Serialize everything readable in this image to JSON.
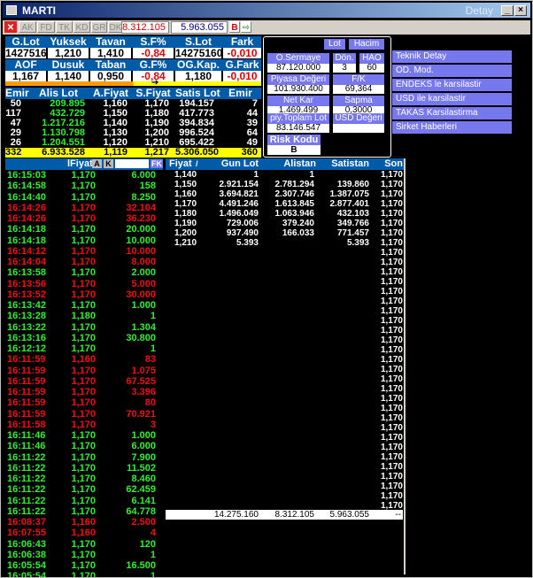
{
  "window": {
    "title": "MARTI",
    "detay_label": "Detay"
  },
  "toolbar": {
    "tabs": [
      "AK",
      "FD",
      "TK",
      "KD",
      "GR",
      "DK"
    ],
    "price": "8.312.105",
    "volume": "5.963.055",
    "b_label": "B"
  },
  "summary": {
    "row1_headers": [
      "G.Lot",
      "Yuksek",
      "Tavan",
      "S.F%",
      "S.Lot",
      "Fark"
    ],
    "row1_values": [
      "14275160",
      "1,210",
      "1,410",
      "-0,84",
      "14275160",
      "-0,010"
    ],
    "row2_headers": [
      "AOF",
      "Dusuk",
      "Taban",
      "G.F%",
      "OG.Kap.",
      "G.Fark"
    ],
    "row2_values": [
      "1,167",
      "1,140",
      "0,950",
      "-0,84",
      "1,180",
      "-0,010"
    ]
  },
  "depth": {
    "headers": [
      "Emir",
      "Alis Lot",
      "A.Fiyat",
      "S.Fiyat",
      "Satis Lot",
      "Emir"
    ],
    "rows": [
      [
        "50",
        "209.895",
        "1,160",
        "1,170",
        "194.157",
        "7"
      ],
      [
        "117",
        "432.729",
        "1,150",
        "1,180",
        "417.773",
        "44"
      ],
      [
        "47",
        "1.217.216",
        "1,140",
        "1,190",
        "394.834",
        "39"
      ],
      [
        "29",
        "1.130.798",
        "1,130",
        "1,200",
        "996.524",
        "64"
      ],
      [
        "26",
        "1.204.551",
        "1,120",
        "1,210",
        "695.422",
        "49"
      ]
    ],
    "total": [
      "332",
      "6.933.528",
      "1,119",
      "1,217",
      "5.306.050",
      "360"
    ]
  },
  "panel": {
    "lot_label": "Lot",
    "hacim_label": "Hacim",
    "osermaye_label": "O.Sermaye",
    "osermaye_value": "87.120.000",
    "don_label": "Dön.",
    "don_value": "3",
    "hao_label": "HAO",
    "hao_value": "60",
    "piyasa_label": "Piyasa Değeri",
    "piyasa_value": "101.930.400",
    "fk_label": "F/K",
    "fk_value": "69,364",
    "netkar_label": "Net Kar",
    "netkar_value": "1.469.499",
    "sapma_label": "Sapma",
    "sapma_value": "0,3000",
    "piytop_label": "piy.Toplam Lot",
    "piytop_value": "83.146.547",
    "usd_label": "USD Değeri",
    "risk_label": "Risk Kodu",
    "risk_value": "B"
  },
  "menu": [
    "Teknik Detay",
    "OD. Mod.",
    "ENDEKS le karsilastir",
    "USD ile karsilastir",
    "TAKAS Karsilastirma",
    "Sirket Haberleri"
  ],
  "trades_header": {
    "fiyat": "lFiyat",
    "a": "A",
    "k": "K",
    "fk": "FK"
  },
  "trades": [
    [
      "16:15:03",
      "1,170",
      "6.000",
      "g"
    ],
    [
      "16:14:58",
      "1,170",
      "158",
      "g"
    ],
    [
      "16:14:40",
      "1,170",
      "8.250",
      "g"
    ],
    [
      "16:14:26",
      "1,170",
      "32.104",
      "r"
    ],
    [
      "16:14:26",
      "1,170",
      "36.230",
      "r"
    ],
    [
      "16:14:18",
      "1,170",
      "20.000",
      "g"
    ],
    [
      "16:14:18",
      "1,170",
      "10.000",
      "g"
    ],
    [
      "16:14:12",
      "1,170",
      "10.000",
      "r"
    ],
    [
      "16:14:04",
      "1,170",
      "8.000",
      "r"
    ],
    [
      "16:13:58",
      "1,170",
      "2.000",
      "g"
    ],
    [
      "16:13:56",
      "1,170",
      "5.000",
      "r"
    ],
    [
      "16:13:52",
      "1,170",
      "30.000",
      "r"
    ],
    [
      "16:13:42",
      "1,170",
      "1.000",
      "g"
    ],
    [
      "16:13:28",
      "1,180",
      "1",
      "g"
    ],
    [
      "16:13:22",
      "1,170",
      "1.304",
      "g"
    ],
    [
      "16:13:16",
      "1,170",
      "30.800",
      "g"
    ],
    [
      "16:12:12",
      "1,170",
      "1",
      "g"
    ],
    [
      "16:11:59",
      "1,160",
      "83",
      "r"
    ],
    [
      "16:11:59",
      "1,170",
      "1.075",
      "r"
    ],
    [
      "16:11:59",
      "1,170",
      "67.525",
      "r"
    ],
    [
      "16:11:59",
      "1,170",
      "3.396",
      "r"
    ],
    [
      "16:11:59",
      "1,170",
      "80",
      "r"
    ],
    [
      "16:11:59",
      "1,170",
      "70.921",
      "r"
    ],
    [
      "16:11:58",
      "1,170",
      "3",
      "r"
    ],
    [
      "16:11:46",
      "1,170",
      "1.000",
      "g"
    ],
    [
      "16:11:46",
      "1,170",
      "6.000",
      "g"
    ],
    [
      "16:11:22",
      "1,170",
      "7.900",
      "g"
    ],
    [
      "16:11:22",
      "1,170",
      "11.502",
      "g"
    ],
    [
      "16:11:22",
      "1,170",
      "8.460",
      "g"
    ],
    [
      "16:11:22",
      "1,170",
      "62.459",
      "g"
    ],
    [
      "16:11:22",
      "1,170",
      "6.141",
      "g"
    ],
    [
      "16:11:22",
      "1,170",
      "64.778",
      "g"
    ],
    [
      "16:08:37",
      "1,160",
      "2.500",
      "r"
    ],
    [
      "16:07:55",
      "1,160",
      "4",
      "r"
    ],
    [
      "16:06:43",
      "1,170",
      "120",
      "g"
    ],
    [
      "16:06:38",
      "1,170",
      "1",
      "g"
    ],
    [
      "16:05:54",
      "1,170",
      "16.500",
      "g"
    ],
    [
      "16:05:54",
      "1,170",
      "1",
      "g"
    ]
  ],
  "distribution_header": [
    "Fiyat",
    "Gun Lot",
    "Alistan",
    "Satistan"
  ],
  "distribution": [
    [
      "1,140",
      "1",
      "1",
      ""
    ],
    [
      "1,150",
      "2.921.154",
      "2.781.294",
      "139.860"
    ],
    [
      "1,160",
      "3.694.821",
      "2.307.746",
      "1.387.075"
    ],
    [
      "1,170",
      "4.491.246",
      "1.613.845",
      "2.877.401"
    ],
    [
      "1,180",
      "1.496.049",
      "1.063.946",
      "432.103"
    ],
    [
      "1,190",
      "729.006",
      "379.240",
      "349.766"
    ],
    [
      "1,200",
      "937.490",
      "166.033",
      "771.457"
    ],
    [
      "1,210",
      "5.393",
      "",
      "5.393"
    ]
  ],
  "distribution_total": [
    "14.275.160",
    "8.312.105",
    "5.963.055",
    "--"
  ],
  "son_header": "Son",
  "son_value": "1,170",
  "colors": {
    "green": "#33ee33",
    "red": "#ee1111",
    "header": "#005ba9",
    "panel_btn": "#7777ee"
  }
}
